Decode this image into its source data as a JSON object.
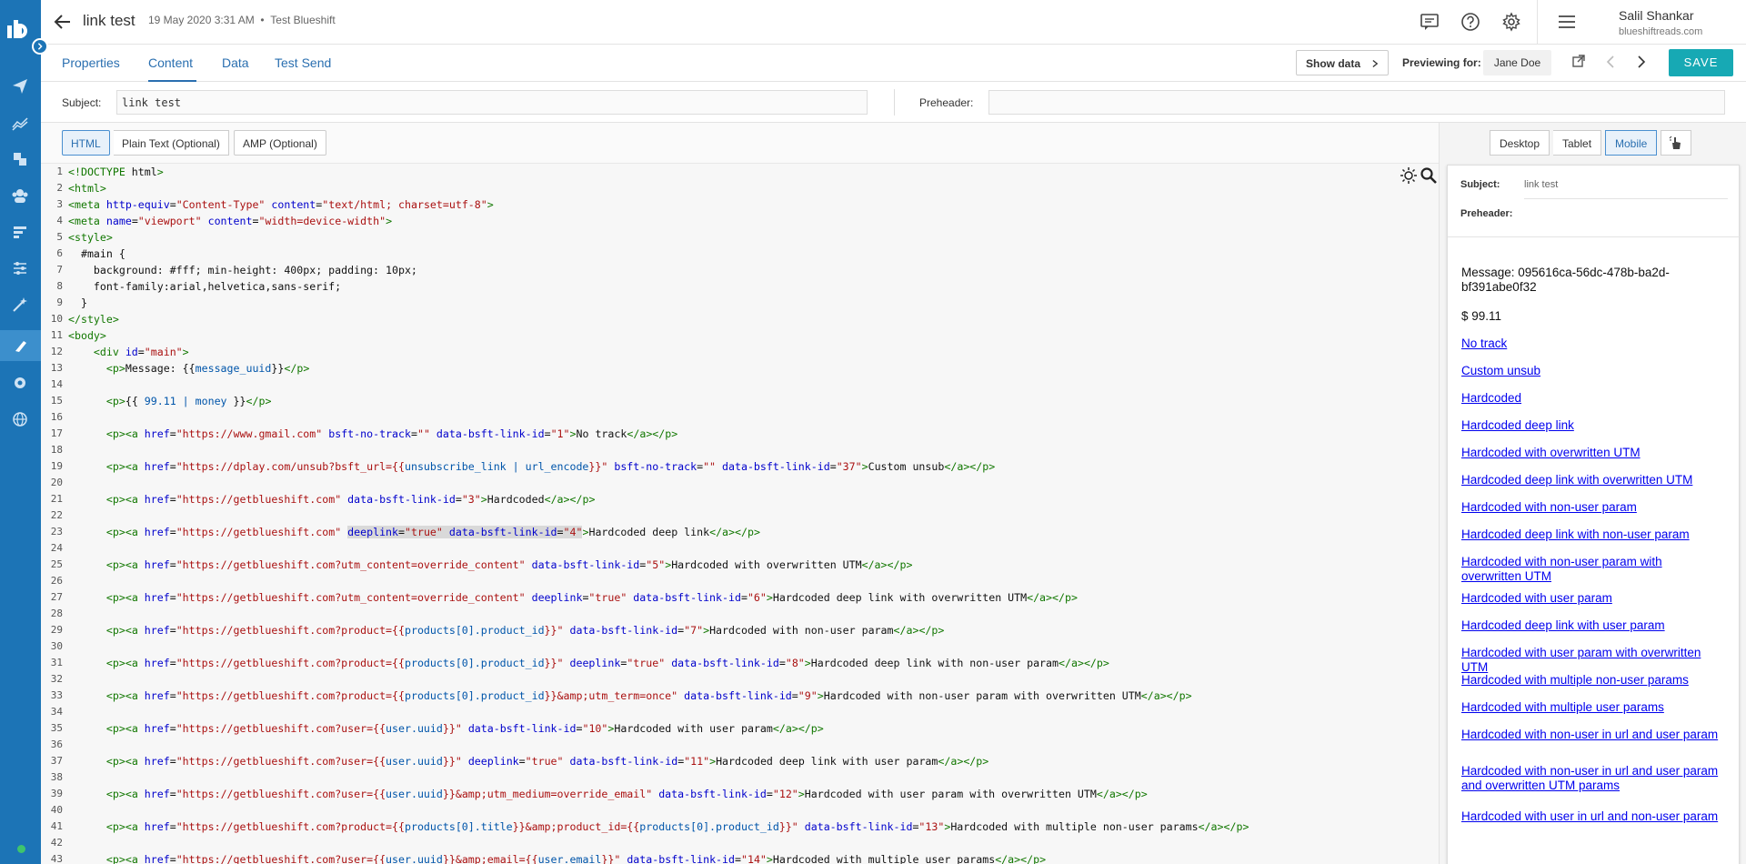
{
  "header": {
    "title": "link test",
    "date": "19 May 2020 3:31 AM",
    "separator": "•",
    "workspace": "Test Blueshift",
    "user_name": "Salil Shankar",
    "user_domain": "blueshiftreads.com"
  },
  "tabs": [
    "Properties",
    "Content",
    "Data",
    "Test Send"
  ],
  "toolbar": {
    "show_data": "Show data",
    "previewing_for": "Previewing for:",
    "preview_user": "Jane Doe",
    "save": "SAVE"
  },
  "subject": {
    "label": "Subject:",
    "value": "link test"
  },
  "preheader": {
    "label": "Preheader:",
    "value": ""
  },
  "formats": [
    "HTML",
    "Plain Text (Optional)",
    "AMP (Optional)"
  ],
  "devices": [
    "Desktop",
    "Tablet",
    "Mobile"
  ],
  "colors": {
    "nav": "#1c74b6",
    "accent": "#17a9b4",
    "link": "#2a6fb0"
  },
  "code_lines": [
    "<!DOCTYPE html>",
    "<html>",
    "<meta http-equiv=\"Content-Type\" content=\"text/html; charset=utf-8\">",
    "<meta name=\"viewport\" content=\"width=device-width\">",
    "<style>",
    "  #main {",
    "    background: #fff; min-height: 400px; padding: 10px;",
    "    font-family:arial,helvetica,sans-serif;",
    "  }",
    "</style>",
    "<body>",
    "    <div id=\"main\">",
    "      <p>Message: {{message_uuid}}</p>",
    "",
    "      <p>{{ 99.11 | money }}</p>",
    "",
    "      <p><a href=\"https://www.gmail.com\" bsft-no-track=\"\" data-bsft-link-id=\"1\">No track</a></p>",
    "",
    "      <p><a href=\"https://dplay.com/unsub?bsft_url={{unsubscribe_link | url_encode}}\" bsft-no-track=\"\" data-bsft-link-id=\"37\">Custom unsub</a></p>",
    "",
    "      <p><a href=\"https://getblueshift.com\" data-bsft-link-id=\"3\">Hardcoded</a></p>",
    "",
    "      <p><a href=\"https://getblueshift.com\" deeplink=\"true\" data-bsft-link-id=\"4\">Hardcoded deep link</a></p>",
    "",
    "      <p><a href=\"https://getblueshift.com?utm_content=override_content\" data-bsft-link-id=\"5\">Hardcoded with overwritten UTM</a></p>",
    "",
    "      <p><a href=\"https://getblueshift.com?utm_content=override_content\" deeplink=\"true\" data-bsft-link-id=\"6\">Hardcoded deep link with overwritten UTM</a></p>",
    "",
    "      <p><a href=\"https://getblueshift.com?product={{products[0].product_id}}\" data-bsft-link-id=\"7\">Hardcoded with non-user param</a></p>",
    "",
    "      <p><a href=\"https://getblueshift.com?product={{products[0].product_id}}\" deeplink=\"true\" data-bsft-link-id=\"8\">Hardcoded deep link with non-user param</a></p>",
    "",
    "      <p><a href=\"https://getblueshift.com?product={{products[0].product_id}}&amp;utm_term=once\" data-bsft-link-id=\"9\">Hardcoded with non-user param with overwritten UTM</a></p>",
    "",
    "      <p><a href=\"https://getblueshift.com?user={{user.uuid}}\" data-bsft-link-id=\"10\">Hardcoded with user param</a></p>",
    "",
    "      <p><a href=\"https://getblueshift.com?user={{user.uuid}}\" deeplink=\"true\" data-bsft-link-id=\"11\">Hardcoded deep link with user param</a></p>",
    "",
    "      <p><a href=\"https://getblueshift.com?user={{user.uuid}}&amp;utm_medium=override_email\" data-bsft-link-id=\"12\">Hardcoded with user param with overwritten UTM</a></p>",
    "",
    "      <p><a href=\"https://getblueshift.com?product={{products[0].title}}&amp;product_id={{products[0].product_id}}\" data-bsft-link-id=\"13\">Hardcoded with multiple non-user params</a></p>",
    "",
    "      <p><a href=\"https://getblueshift.com?user={{user.uuid}}&amp;email={{user.email}}\" data-bsft-link-id=\"14\">Hardcoded with multiple user params</a></p>"
  ],
  "preview": {
    "subject_label": "Subject:",
    "subject_value": "link test",
    "preheader_label": "Preheader:",
    "body": [
      {
        "text": "Message: 095616ca-56dc-478b-ba2d-bf391abe0f32",
        "link": false
      },
      {
        "text": "$ 99.11",
        "link": false
      },
      {
        "text": "No track",
        "link": true
      },
      {
        "text": "Custom unsub",
        "link": true
      },
      {
        "text": "Hardcoded",
        "link": true
      },
      {
        "text": "Hardcoded deep link",
        "link": true
      },
      {
        "text": "Hardcoded with overwritten UTM",
        "link": true
      },
      {
        "text": "Hardcoded deep link with overwritten UTM",
        "link": true
      },
      {
        "text": "Hardcoded with non-user param",
        "link": true
      },
      {
        "text": "Hardcoded deep link with non-user param",
        "link": true
      },
      {
        "text": "Hardcoded with non-user param with overwritten UTM",
        "link": true
      },
      {
        "text": "Hardcoded with user param",
        "link": true
      },
      {
        "text": "Hardcoded deep link with user param",
        "link": true
      },
      {
        "text": "Hardcoded with user param with overwritten UTM",
        "link": true
      },
      {
        "text": "Hardcoded with multiple non-user params",
        "link": true
      },
      {
        "text": "Hardcoded with multiple user params",
        "link": true
      },
      {
        "text": "Hardcoded with non-user in url and user param",
        "link": true
      },
      {
        "text": "Hardcoded with non-user in url and user param and overwritten UTM params",
        "link": true
      },
      {
        "text": "Hardcoded with user in url and non-user param",
        "link": true
      }
    ]
  }
}
